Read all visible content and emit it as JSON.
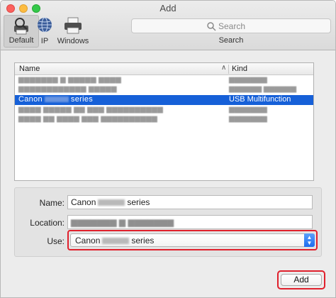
{
  "window": {
    "title": "Add"
  },
  "toolbar": {
    "items": [
      {
        "label": "Default",
        "icon": "default-printer-icon"
      },
      {
        "label": "IP",
        "icon": "globe-icon"
      },
      {
        "label": "Windows",
        "icon": "windows-printer-icon"
      }
    ],
    "search": {
      "placeholder": "Search",
      "caption": "Search"
    }
  },
  "table": {
    "headers": {
      "name": "Name",
      "kind": "Kind"
    },
    "rows": [
      {
        "name": "",
        "kind": ""
      },
      {
        "name": "",
        "kind": ""
      },
      {
        "name_prefix": "Canon",
        "name_suffix": "series",
        "kind": "USB Multifunction",
        "selected": true
      },
      {
        "name": "",
        "kind": ""
      },
      {
        "name": "",
        "kind": ""
      }
    ]
  },
  "form": {
    "name_label": "Name:",
    "name_prefix": "Canon",
    "name_suffix": "series",
    "location_label": "Location:",
    "use_label": "Use:",
    "use_prefix": "Canon",
    "use_suffix": "series"
  },
  "actions": {
    "add_label": "Add"
  },
  "colors": {
    "selection": "#1660d8",
    "highlight": "#e0202c"
  }
}
